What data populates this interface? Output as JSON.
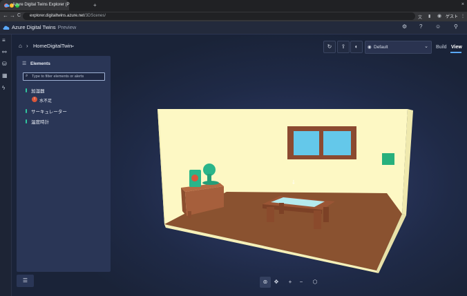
{
  "browser": {
    "tab_title": "Azure Digital Twins Explorer (P",
    "tab_close": "×",
    "new_tab": "+",
    "url_host": "explorer.digitaltwins.azure.net",
    "url_path": "/3DScenes/",
    "back": "←",
    "forward": "→",
    "reload": "C",
    "profile_label": "ゲスト",
    "colors": {
      "red": "#ff5f57",
      "yellow": "#febc2e",
      "green": "#28c840"
    }
  },
  "app": {
    "title": "Azure Digital Twins",
    "badge": "Preview",
    "header_icons": [
      "settings-icon",
      "help-icon",
      "feedback-icon",
      "account-icon"
    ]
  },
  "rail": {
    "icons": [
      "menu-icon",
      "graph-icon",
      "models-icon",
      "scenes-icon",
      "lightning-icon"
    ]
  },
  "breadcrumb": {
    "home": "⌂",
    "separator": "›",
    "twin": "HomeDigitalTwin",
    "chevron": "⌄"
  },
  "controls": {
    "scene_select": "Default",
    "tab_build": "Build",
    "tab_view": "View",
    "accent": "#5aa9ff"
  },
  "elements_panel": {
    "title": "Elements",
    "filter_placeholder": "Type to filter elements or alerts",
    "items": [
      {
        "label": "加湿器"
      },
      {
        "label": "サーキュレーター"
      },
      {
        "label": "温度時計"
      }
    ],
    "alert": {
      "badge": "!",
      "label": "水不足"
    },
    "status_color": "#2fc7a0"
  }
}
